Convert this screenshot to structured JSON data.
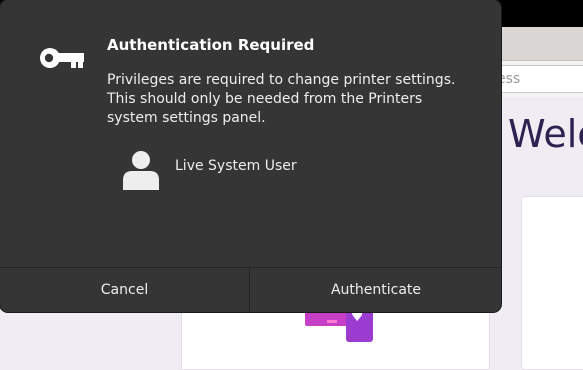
{
  "dialog": {
    "title": "Authentication Required",
    "message": "Privileges are required to change printer settings. This should only be needed from the Printers system settings panel.",
    "icon": "key-icon",
    "user": {
      "name": "Live System User",
      "icon": "user-avatar-icon"
    },
    "buttons": {
      "cancel": "Cancel",
      "authenticate": "Authenticate"
    }
  },
  "background": {
    "search_placeholder_fragment": "ess",
    "welcome_fragment": "Welc"
  },
  "colors": {
    "dialog_bg": "#353535",
    "page_bg": "#efedf3",
    "welcome_text": "#2b2250",
    "accent_magenta": "#c73fc7",
    "accent_purple": "#9b3bcf"
  }
}
